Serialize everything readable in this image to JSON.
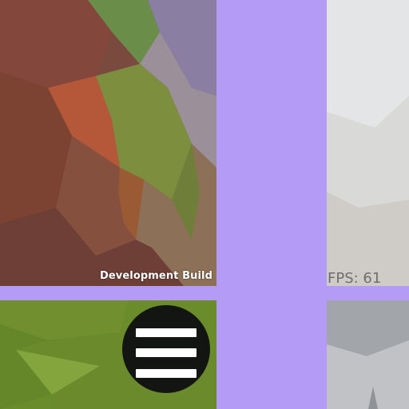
{
  "overlay": {
    "dev_build_label": "Development Build",
    "fps_label": "FPS: 61"
  },
  "menu_button": {
    "icon": "hamburger-menu-icon"
  },
  "colors": {
    "background": "#b39bf6",
    "menu_button": "#121511",
    "menu_bars": "#ffffff",
    "fps_text": "#6e6e6e"
  }
}
